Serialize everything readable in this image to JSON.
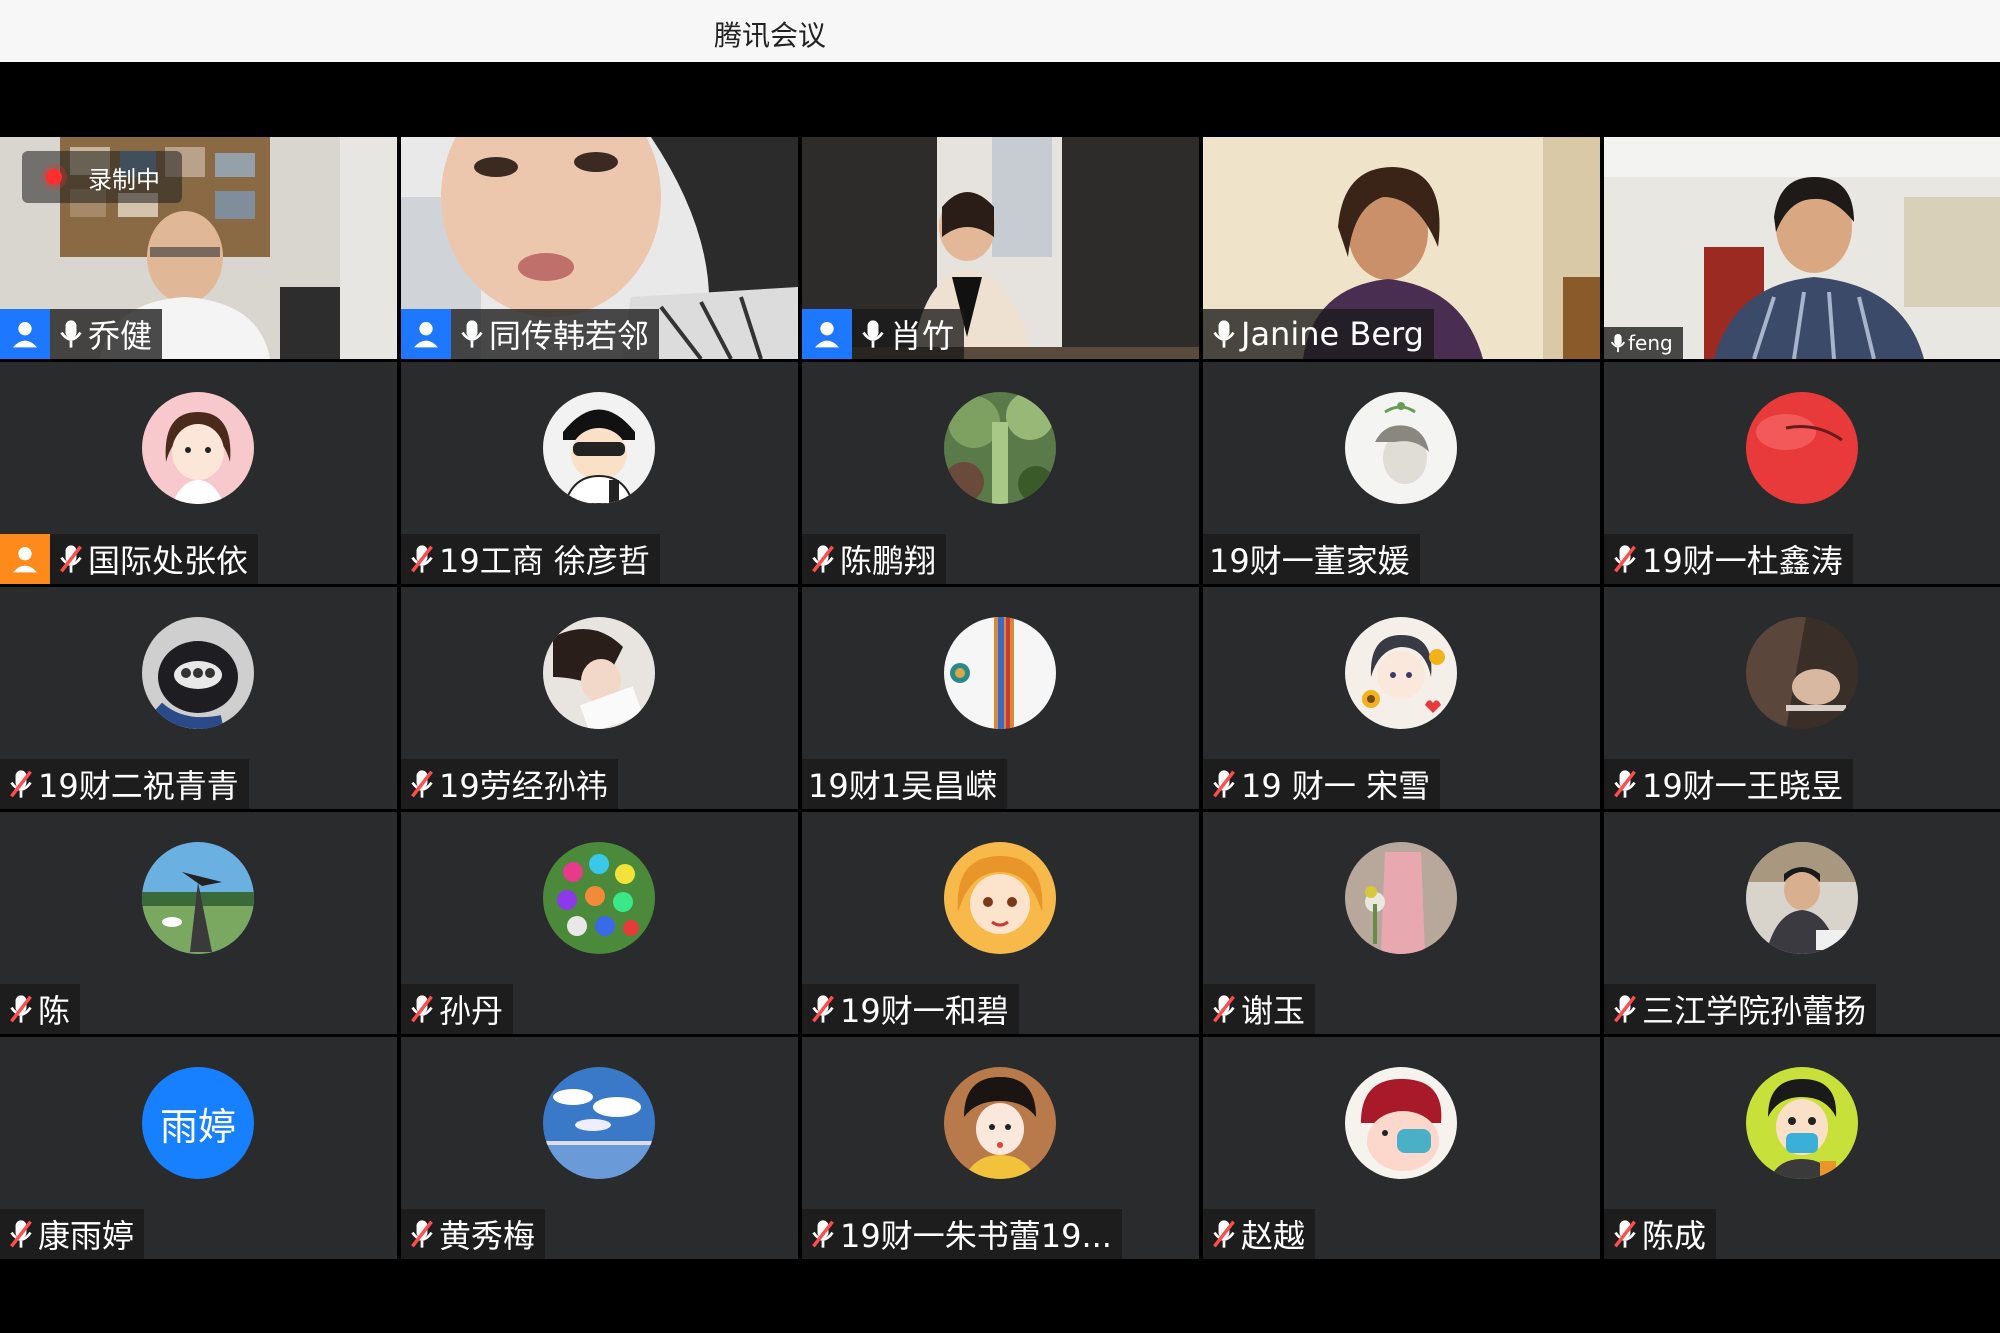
{
  "app": {
    "title": "腾讯会议"
  },
  "recording": {
    "label": "录制中"
  },
  "participants": [
    {
      "name": "乔健",
      "host": "blue",
      "mic": "on"
    },
    {
      "name": "同传韩若邻",
      "host": "blue",
      "mic": "on"
    },
    {
      "name": "肖竹",
      "host": "blue",
      "mic": "on"
    },
    {
      "name": "Janine Berg",
      "host": "",
      "mic": "on"
    },
    {
      "name": "feng",
      "host": "",
      "mic": "on"
    },
    {
      "name": "国际处张依",
      "host": "orange",
      "mic": "muted"
    },
    {
      "name": "19工商 徐彦哲",
      "host": "",
      "mic": "muted"
    },
    {
      "name": "陈鹏翔",
      "host": "",
      "mic": "muted"
    },
    {
      "name": "19财一董家媛",
      "host": "",
      "mic": "none"
    },
    {
      "name": "19财一杜鑫涛",
      "host": "",
      "mic": "muted"
    },
    {
      "name": "19财二祝青青",
      "host": "",
      "mic": "muted"
    },
    {
      "name": "19劳经孙祎",
      "host": "",
      "mic": "muted"
    },
    {
      "name": "19财1吴昌嵘",
      "host": "",
      "mic": "none"
    },
    {
      "name": "19 财一 宋雪",
      "host": "",
      "mic": "muted"
    },
    {
      "name": "19财一王晓昱",
      "host": "",
      "mic": "muted"
    },
    {
      "name": "陈",
      "host": "",
      "mic": "muted"
    },
    {
      "name": "孙丹",
      "host": "",
      "mic": "muted"
    },
    {
      "name": "19财一和碧",
      "host": "",
      "mic": "muted"
    },
    {
      "name": "谢玉",
      "host": "",
      "mic": "muted"
    },
    {
      "name": "三江学院孙蕾扬",
      "host": "",
      "mic": "muted"
    },
    {
      "name": "康雨婷",
      "host": "",
      "mic": "muted",
      "avatar_text": "雨婷"
    },
    {
      "name": "黄秀梅",
      "host": "",
      "mic": "muted"
    },
    {
      "name": "19财一朱书蕾19...",
      "host": "",
      "mic": "muted"
    },
    {
      "name": "赵越",
      "host": "",
      "mic": "muted"
    },
    {
      "name": "陈成",
      "host": "",
      "mic": "muted"
    }
  ],
  "colors": {
    "host_blue": "#1d78ff",
    "host_orange": "#ff8a1c",
    "tile_bg": "#2a2b2d",
    "mute_red": "#ff4d4f"
  }
}
